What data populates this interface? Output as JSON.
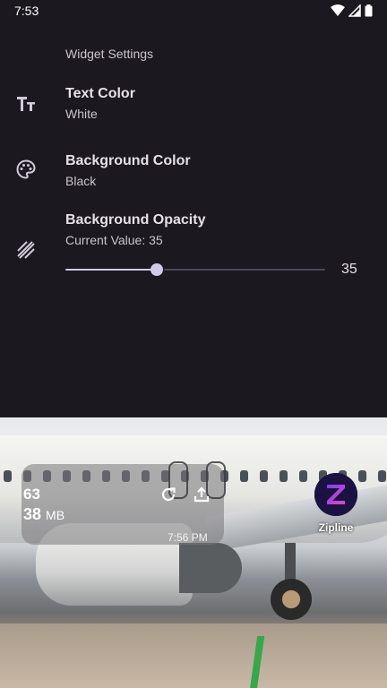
{
  "status_bar": {
    "time": "7:53"
  },
  "settings": {
    "section_title": "Widget Settings",
    "items": [
      {
        "title": "Text Color",
        "value": "White",
        "icon": "text-format-icon"
      },
      {
        "title": "Background Color",
        "value": "Black",
        "icon": "palette-icon"
      },
      {
        "title": "Background Opacity",
        "value": "Current Value: 35",
        "icon": "opacity-icon"
      }
    ],
    "opacity_slider": {
      "value": 35,
      "min": 0,
      "max": 100,
      "display": "35"
    }
  },
  "widget_preview": {
    "cpu": "63",
    "ram_value": "38",
    "ram_unit": "MB",
    "time": "7:56 PM",
    "refresh_icon": "refresh-icon",
    "share_icon": "share-icon"
  },
  "app_shortcut": {
    "label": "Zipline",
    "letter": "Z"
  },
  "colors": {
    "background": "#1b181f",
    "primary_text": "#e6e0e9",
    "secondary_text": "#cac4d0",
    "slider_active": "#d0cbe6",
    "app_icon_gradient": [
      "#7b3ff2",
      "#e547c5"
    ]
  }
}
